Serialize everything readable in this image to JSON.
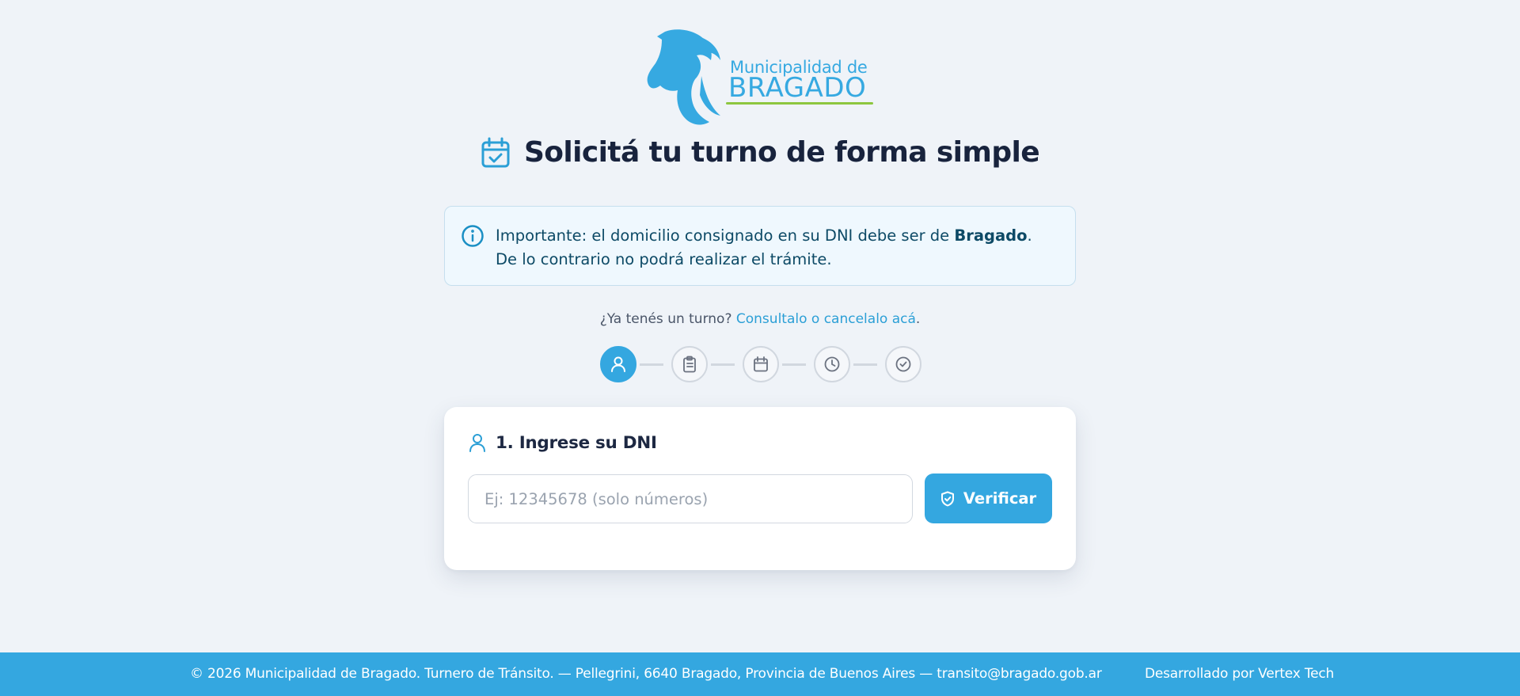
{
  "logo": {
    "line1": "Municipalidad de",
    "line2": "BRAGADO"
  },
  "heading": {
    "title": "Solicitá tu turno de forma simple",
    "icon": "calendar-check-icon"
  },
  "notice": {
    "icon": "info-icon",
    "prefix": "Importante: el domicilio consignado en su DNI debe ser de ",
    "bold": "Bragado",
    "suffix": ". De lo contrario no podrá realizar el trámite."
  },
  "existing_turn": {
    "question": "¿Ya tenés un turno?",
    "link": "Consultalo o cancelalo acá",
    "end": "."
  },
  "stepper": {
    "steps": [
      {
        "icon": "user-icon",
        "active": true
      },
      {
        "icon": "clipboard-icon",
        "active": false
      },
      {
        "icon": "calendar-icon",
        "active": false
      },
      {
        "icon": "clock-icon",
        "active": false
      },
      {
        "icon": "check-circle-icon",
        "active": false
      }
    ]
  },
  "dni_card": {
    "title": "1. Ingrese su DNI",
    "input_value": "",
    "input_placeholder": "Ej: 12345678 (solo números)",
    "button_label": "Verificar"
  },
  "footer": {
    "left": "© 2026 Municipalidad de Bragado. Turnero de Tránsito. — Pellegrini, 6640 Bragado, Provincia de Buenos Aires — transito@bragado.gob.ar",
    "right": "Desarrollado por Vertex Tech"
  },
  "colors": {
    "accent": "#34a7e0",
    "background": "#eff3f8",
    "notice_bg": "#eff8fe",
    "logo_green": "#8dc63f"
  }
}
